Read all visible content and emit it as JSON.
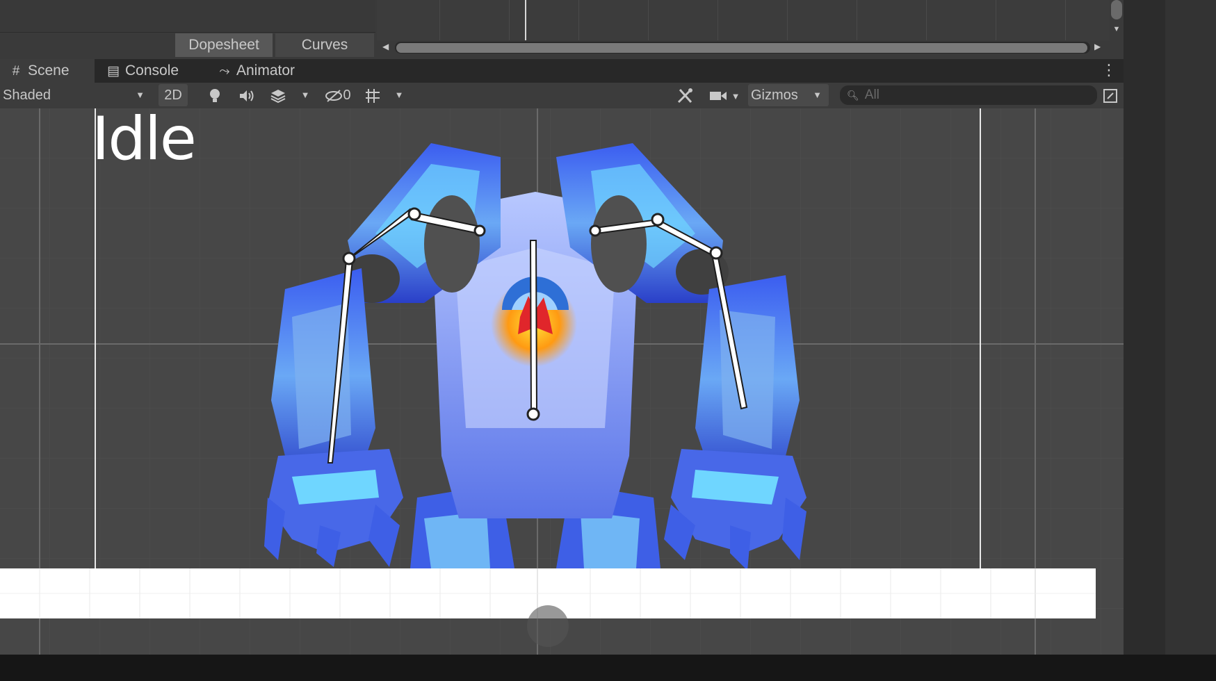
{
  "animation_window": {
    "tabs": [
      {
        "label": "Dopesheet"
      },
      {
        "label": "Curves"
      }
    ]
  },
  "panel_tabs": [
    {
      "label": "Scene",
      "icon": "scene-grid-icon",
      "active": true
    },
    {
      "label": "Console",
      "icon": "console-icon",
      "active": false
    },
    {
      "label": "Animator",
      "icon": "animator-icon",
      "active": false
    }
  ],
  "toolbar": {
    "draw_mode": "Shaded",
    "mode_2d": "2D",
    "hidden_count": "0",
    "gizmos": "Gizmos",
    "search_placeholder": "All"
  },
  "scene": {
    "state_label": "Idle",
    "character": "blue crystal golem sprite with bone rig"
  },
  "colors": {
    "panel_bg": "#3c3c3c",
    "scene_bg": "#474747",
    "grid_line": "#555555",
    "bone": "#ffffff",
    "crystal_dark": "#2a3fc8",
    "crystal_light": "#6fd6ff"
  }
}
